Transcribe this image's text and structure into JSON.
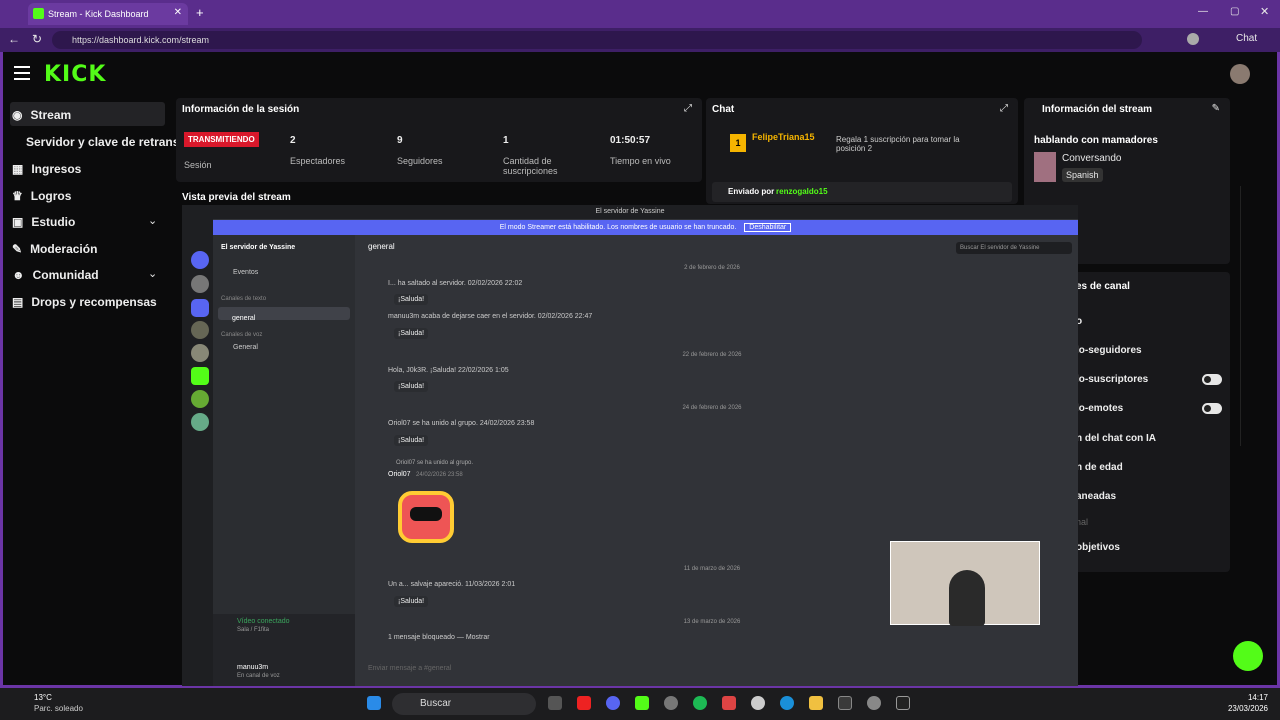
{
  "browser": {
    "tab_title": "Stream - Kick Dashboard",
    "url": "https://dashboard.kick.com/stream",
    "chat_label": "Chat"
  },
  "sidebar": {
    "items": [
      {
        "label": "Stream"
      },
      {
        "label": "Servidor y clave de retransm"
      },
      {
        "label": "Ingresos"
      },
      {
        "label": "Logros"
      },
      {
        "label": "Estudio"
      },
      {
        "label": "Moderación"
      },
      {
        "label": "Comunidad"
      },
      {
        "label": "Drops y recompensas"
      }
    ]
  },
  "session": {
    "title": "Información de la sesión",
    "badge": "TRANSMITIENDO",
    "badge_label": "Sesión",
    "stats": [
      {
        "value": "2",
        "label": "Espectadores"
      },
      {
        "value": "9",
        "label": "Seguidores"
      },
      {
        "value": "1",
        "label": "Cantidad de suscripciones"
      },
      {
        "value": "01:50:57",
        "label": "Tiempo en vivo"
      }
    ]
  },
  "preview": {
    "title": "Vista previa del stream"
  },
  "chat": {
    "title": "Chat",
    "user": "FelipeTriana15",
    "user_count": "1",
    "promo": "Regala 1 suscripción para tomar la posición 2",
    "pinned_label": "Enviado por",
    "pinned_user": "renzogaldo15"
  },
  "stream_info": {
    "title": "Información del stream",
    "stream_title": "hablando con mamadores",
    "category": "Conversando",
    "language": "Spanish"
  },
  "settings": {
    "title_partial": "es de canal",
    "rows": [
      "o",
      "lo-seguidores",
      "lo-suscriptores",
      "lo-emotes",
      "n del chat con IA",
      "n de edad",
      "aneadas",
      "nal",
      "objetivos"
    ]
  },
  "discord": {
    "window_title": "El servidor de Yassine",
    "banner": "El modo Streamer está habilitado. Los nombres de usuario se han truncado.",
    "banner_button": "Deshabilitar",
    "server_name": "El servidor de Yassine",
    "channel": "general",
    "search_placeholder": "Buscar El servidor de Yassine",
    "events": "Eventos",
    "text_channels": "Canales de texto",
    "voice_channels": "Canales de voz",
    "voice_general": "General",
    "messages": [
      {
        "date": "2 de febrero de 2026"
      },
      {
        "text": "I... ha saltado al servidor. 02/02/2026 22:02",
        "action": "¡Saluda!"
      },
      {
        "text": "manuu3m acaba de dejarse caer en el servidor. 02/02/2026 22:47",
        "action": "¡Saluda!"
      },
      {
        "date": "22 de febrero de 2026"
      },
      {
        "text": "Hola, J0k3R. ¡Saluda! 22/02/2026 1:05",
        "action": "¡Saluda!"
      },
      {
        "date": "24 de febrero de 2026"
      },
      {
        "text": "Oriol07 se ha unido al grupo. 24/02/2026 23:58",
        "action": "¡Saluda!"
      },
      {
        "reply": "Oriol07 se ha unido al grupo.",
        "author": "Oriol07",
        "time": "24/02/2026 23:58"
      },
      {
        "date": "11 de marzo de 2026"
      },
      {
        "text": "Un a... salvaje apareció. 11/03/2026 2:01",
        "action": "¡Saluda!"
      },
      {
        "date": "13 de marzo de 2026"
      },
      {
        "text": "1 mensaje bloqueado — Mostrar"
      }
    ],
    "composer_placeholder": "Enviar mensaje a #general",
    "voice_status": "Vídeo conectado",
    "voice_sub": "Sala / F1fita",
    "user_name": "manuu3m",
    "user_status": "En canal de voz"
  },
  "taskbar": {
    "weather_temp": "13°C",
    "weather_desc": "Parc. soleado",
    "search": "Buscar",
    "time": "14:17",
    "date": "23/03/2026"
  }
}
